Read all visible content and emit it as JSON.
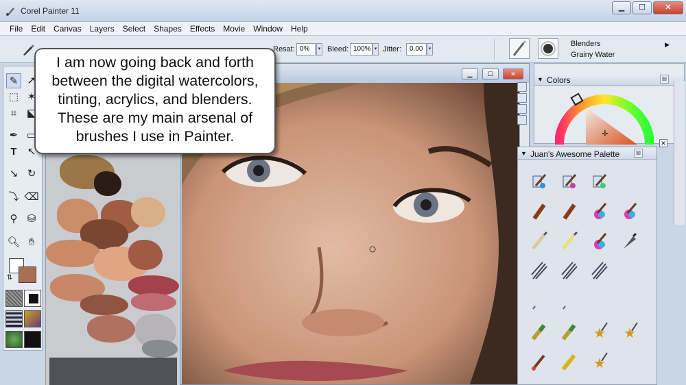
{
  "window": {
    "title": "Corel Painter 11",
    "minimize_glyph": "▁",
    "maximize_glyph": "☐",
    "close_glyph": "✕"
  },
  "menubar": {
    "items": [
      "File",
      "Edit",
      "Canvas",
      "Layers",
      "Select",
      "Shapes",
      "Effects",
      "Movie",
      "Window",
      "Help"
    ]
  },
  "property_bar": {
    "resat_label": "Resat:",
    "resat_value": "0%",
    "bleed_label": "Bleed:",
    "bleed_value": "100%",
    "jitter_label": "Jitter:",
    "jitter_value": "0.00",
    "brush_category": "Blenders",
    "brush_variant": "Grainy Water",
    "variant_arrow": "▶"
  },
  "callout": {
    "lines": [
      "I am now going back and forth",
      "between the digital watercolors,",
      "tinting, acrylics, and blenders.",
      "These are my main arsenal of",
      "brushes I use in Painter."
    ]
  },
  "colors_panel": {
    "title": "Colors",
    "close_glyph": "⊠",
    "collapse_glyph": "▼"
  },
  "custom_palette": {
    "title": "Juan's Awesome Palette",
    "close_glyph": "⊠",
    "collapse_glyph": "▼"
  },
  "colors": {
    "main_color": "#a96f55",
    "secondary_color": "#ffffff",
    "skin_base": "#d0a28b",
    "accent_red": "#c94c3c"
  },
  "icons": {
    "tools": [
      "brush-icon",
      "selection-arrow-icon",
      "rectangle-select-icon",
      "magic-wand-icon",
      "crop-icon",
      "transform-icon",
      "pen-icon",
      "shape-rect-icon",
      "text-icon",
      "shape-select-icon",
      "dropper-stroke-icon",
      "rotate-icon",
      "cloner-icon",
      "eraser-icon",
      "eyedropper-icon",
      "paint-bucket-icon",
      "magnifier-icon",
      "grabber-hand-icon"
    ]
  }
}
